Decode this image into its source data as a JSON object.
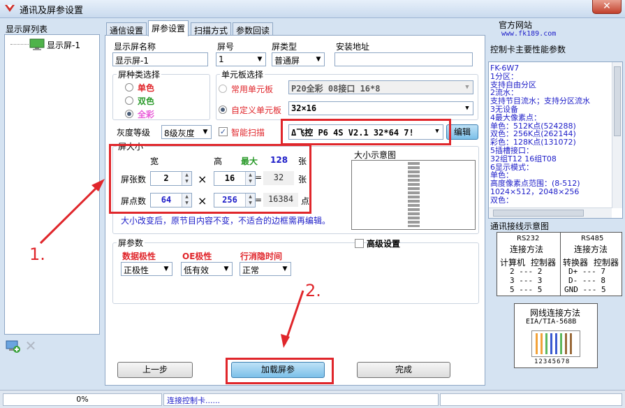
{
  "window": {
    "title": "通讯及屏参设置",
    "close": "✕"
  },
  "sidebar": {
    "title": "显示屏列表",
    "items": [
      {
        "label": "显示屏-1"
      }
    ]
  },
  "tabs": [
    {
      "label": "通信设置"
    },
    {
      "label": "屏参设置"
    },
    {
      "label": "扫描方式"
    },
    {
      "label": "参数回读"
    }
  ],
  "screen_params": {
    "name_label": "显示屏名称",
    "name_value": "显示屏-1",
    "number_label": "屏号",
    "number_value": "1",
    "type_label": "屏类型",
    "type_value": "普通屏",
    "address_label": "安装地址",
    "address_value": ""
  },
  "color_type": {
    "title": "屏种类选择",
    "options": [
      {
        "label": "单色",
        "color": "#e0262b"
      },
      {
        "label": "双色",
        "color": "#2a9a2a"
      },
      {
        "label": "全彩",
        "color": "#e85bd8"
      }
    ]
  },
  "unit_board": {
    "title": "单元板选择",
    "common_label": "常用单元板",
    "common_value": "P20全彩 08接口 16*8",
    "custom_label": "自定义单元板",
    "custom_value": "32×16"
  },
  "gray": {
    "label": "灰度等级",
    "value": "8级灰度"
  },
  "smart_scan": {
    "label": "智能扫描",
    "checked": "✓"
  },
  "controller": {
    "value": "Δ飞控 P6 4S V2.1 32*64 7!",
    "edit_label": "编辑"
  },
  "size": {
    "title": "屏大小",
    "width_header": "宽",
    "height_header": "高",
    "max_label": "最大",
    "max_value": "128",
    "max_unit": "张",
    "panels_label": "屏张数",
    "panels_w": "2",
    "panels_h": "16",
    "panels_total": "32",
    "panels_unit": "张",
    "pixels_label": "屏点数",
    "pixels_w": "64",
    "pixels_h": "256",
    "pixels_total": "16384",
    "pixels_unit": "点",
    "times": "×",
    "equals": "=",
    "hint": "大小改变后，原节目内容不变，不适合的边框需再编辑。"
  },
  "preview": {
    "title": "大小示意图"
  },
  "params": {
    "title": "屏参数",
    "advanced_label": "高级设置",
    "data_polarity_label": "数据极性",
    "data_polarity_value": "正极性",
    "oe_label": "OE极性",
    "oe_value": "低有效",
    "row_label": "行消隐时间",
    "row_value": "正常"
  },
  "buttons": {
    "prev": "上一步",
    "load": "加载屏参",
    "finish": "完成"
  },
  "annotations": {
    "one": "1.",
    "two": "2."
  },
  "right": {
    "site_label": "官方网站",
    "site_url": "www.fk189.com",
    "perf_title": "控制卡主要性能参数",
    "perf_lines": [
      "FK-6W7",
      "1分区：",
      "   支持自由分区",
      "2流水：",
      "   支持节目流水；支持分区流水",
      "3无设备",
      "4最大像素点：",
      "   单色：512K点(524288)",
      "   双色：256K点(262144)",
      "   彩色：128K点(131072)",
      "5插槽接口：",
      "   32组T12  16组T08",
      "6显示模式：",
      "   单色：",
      "   高度像素点范围：(8-512)",
      " 1024×512，2048×256",
      "   双色："
    ],
    "conn_title": "通讯接线示意图",
    "rs232": "RS232",
    "rs485": "RS485",
    "conn_method": "连接方法",
    "pc": "计算机",
    "controller": "控制器",
    "converter": "转换器",
    "rs232_rows": [
      "2 --- 2",
      "3 --- 3",
      "5 --- 5"
    ],
    "rs485_rows": [
      "D+ --- 7",
      "D- --- 8",
      "GND --- 5"
    ],
    "net_title": "网线连接方法",
    "net_std": "EIA/TIA-568B",
    "net_pins": "12345678"
  },
  "status": {
    "progress": "0%",
    "message": "连接控制卡......"
  }
}
